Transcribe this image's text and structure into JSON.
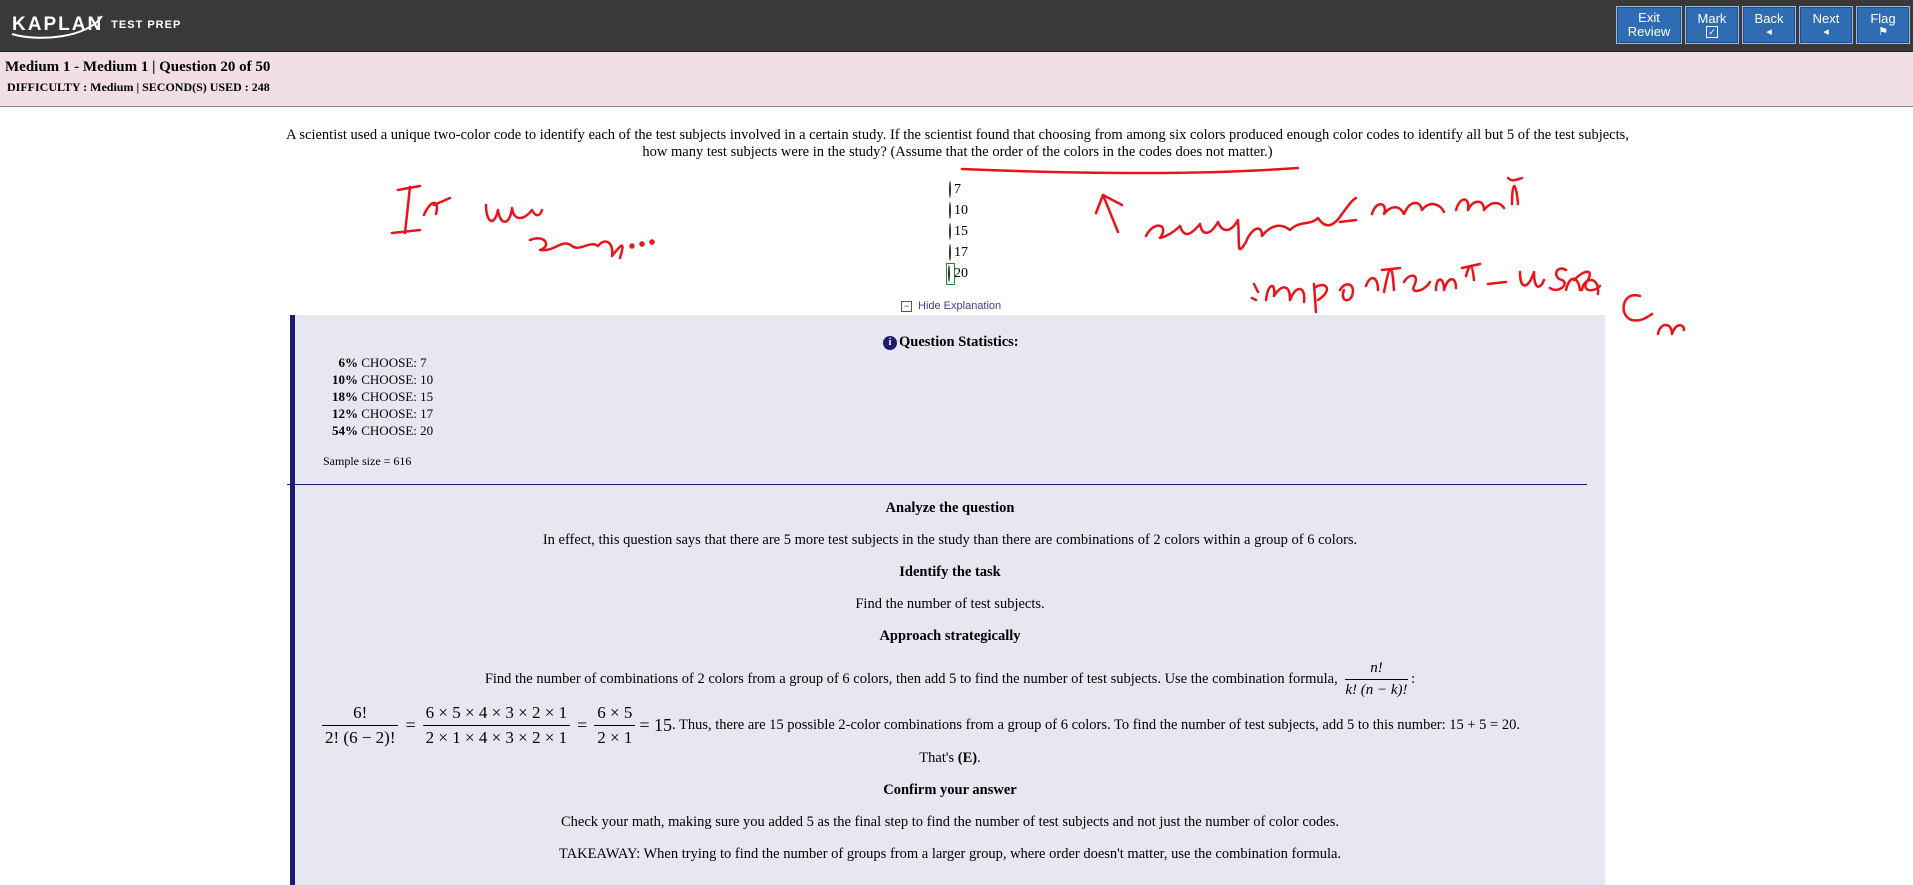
{
  "header": {
    "brand": "KAPLAN",
    "brand_sub": "TEST PREP",
    "buttons": [
      {
        "label_line1": "Exit",
        "label_line2": "Review"
      },
      {
        "label": "Mark",
        "symbol": "✓"
      },
      {
        "label": "Back",
        "symbol": "◂"
      },
      {
        "label": "Next",
        "symbol": "◂"
      },
      {
        "label": "Flag",
        "symbol": "⚑"
      }
    ]
  },
  "info": {
    "title": "Medium 1 - Medium 1 | Question  20 of 50",
    "difficulty": "DIFFICULTY : Medium | SECOND(S) USED : 248"
  },
  "question": {
    "stem": "A scientist used a unique two-color code to identify each of the test subjects involved in a certain study. If the scientist found that choosing from among six colors produced enough color codes to identify all but 5 of the test subjects, how many test subjects were in the study? (Assume that the order of the colors in the codes does not matter.)",
    "choices": [
      "7",
      "10",
      "15",
      "17",
      "20"
    ],
    "selected_index": 4,
    "hide_explanation": "Hide Explanation"
  },
  "statistics": {
    "title": "Question Statistics:",
    "rows": [
      {
        "pct": "6%",
        "label": "CHOOSE: 7"
      },
      {
        "pct": "10%",
        "label": "CHOOSE: 10"
      },
      {
        "pct": "18%",
        "label": "CHOOSE: 15"
      },
      {
        "pct": "12%",
        "label": "CHOOSE: 17"
      },
      {
        "pct": "54%",
        "label": "CHOOSE: 20"
      }
    ],
    "sample": "Sample size = 616"
  },
  "explanation": {
    "h1": "Analyze the question",
    "p1": "In effect, this question says that there are 5 more test subjects in the study than there are combinations of 2 colors within a group of 6 colors.",
    "h2": "Identify the task",
    "p2": "Find the number of test subjects.",
    "h3": "Approach strategically",
    "p3": "Find the number of combinations of 2 colors from a group of 6 colors, then add 5 to find the number of test subjects. Use the combination formula,",
    "formula_num": "n!",
    "formula_den": "k! (n − k)!",
    "formula_tail": ":",
    "eq_f1_num": "6!",
    "eq_f1_den": "2! (6 − 2)!",
    "eq_f2_num": "6 × 5 × 4 × 3 × 2 × 1",
    "eq_f2_den": "2 × 1 × 4 × 3 × 2 × 1",
    "eq_f3_num": "6 × 5",
    "eq_f3_den": "2 × 1",
    "eq_result": "= 15",
    "eq_tail": ". Thus, there are 15 possible 2-color combinations from a group of 6 colors. To find the number of test subjects, add 5 to this number: 15 + 5 = 20.",
    "thats": "That's",
    "answer": "(E)",
    "thats_tail": ".",
    "h4": "Confirm your answer",
    "p4": "Check your math, making sure you added 5 as the final step to find the number of test subjects and not just the number of color codes.",
    "p5": "TAKEAWAY: When trying to find the number of groups from a larger group, where order doesn't matter, use the combination formula."
  },
  "colors": {
    "topbar": "#3a3939",
    "button": "#2e6db4",
    "infostrip": "#f1dfe3",
    "panel": "#e8e6f0",
    "panel_border": "#1e1a6e",
    "annotation": "#e8141c"
  }
}
